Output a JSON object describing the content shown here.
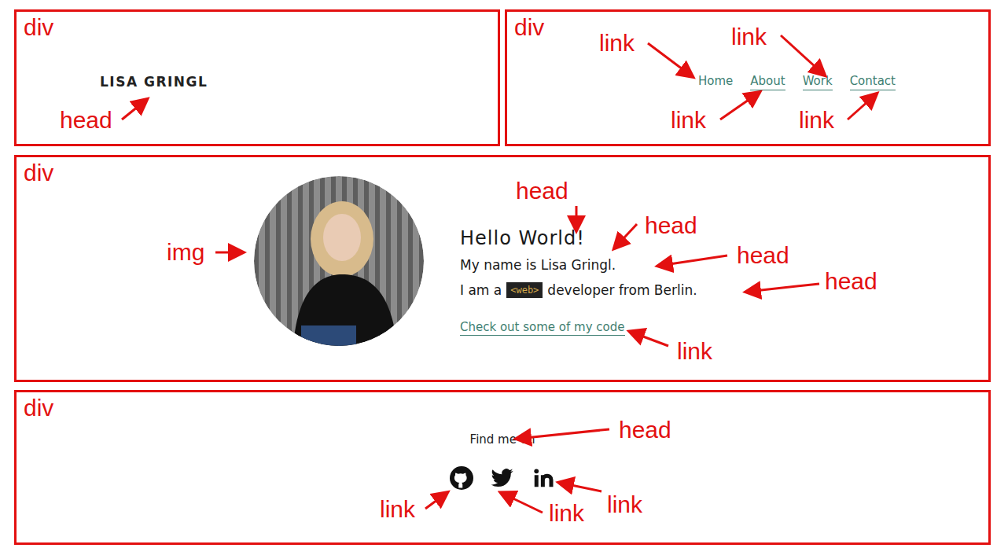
{
  "header": {
    "logo": "LISA GRINGL"
  },
  "nav": {
    "links": [
      {
        "label": "Home",
        "selected": true
      },
      {
        "label": "About",
        "selected": false
      },
      {
        "label": "Work",
        "selected": false
      },
      {
        "label": "Contact",
        "selected": false
      }
    ]
  },
  "hero": {
    "greeting": "Hello World!",
    "name_line": "My name is Lisa Gringl.",
    "role_prefix": "I am a",
    "role_badge": "<web>",
    "role_suffix": "developer from Berlin.",
    "cta": "Check out some of my code"
  },
  "footer": {
    "heading": "Find me on",
    "socials": [
      {
        "kind": "github"
      },
      {
        "kind": "twitter"
      },
      {
        "kind": "linkedin"
      }
    ]
  },
  "annotations": [
    {
      "box_label": "div",
      "tags": [
        "head"
      ]
    },
    {
      "box_label": "div",
      "tags": [
        "link",
        "link",
        "link",
        "link"
      ]
    },
    {
      "box_label": "div",
      "tags": [
        "img",
        "head",
        "head",
        "head",
        "head",
        "link"
      ]
    },
    {
      "box_label": "div",
      "tags": [
        "head",
        "link",
        "link",
        "link"
      ]
    }
  ]
}
